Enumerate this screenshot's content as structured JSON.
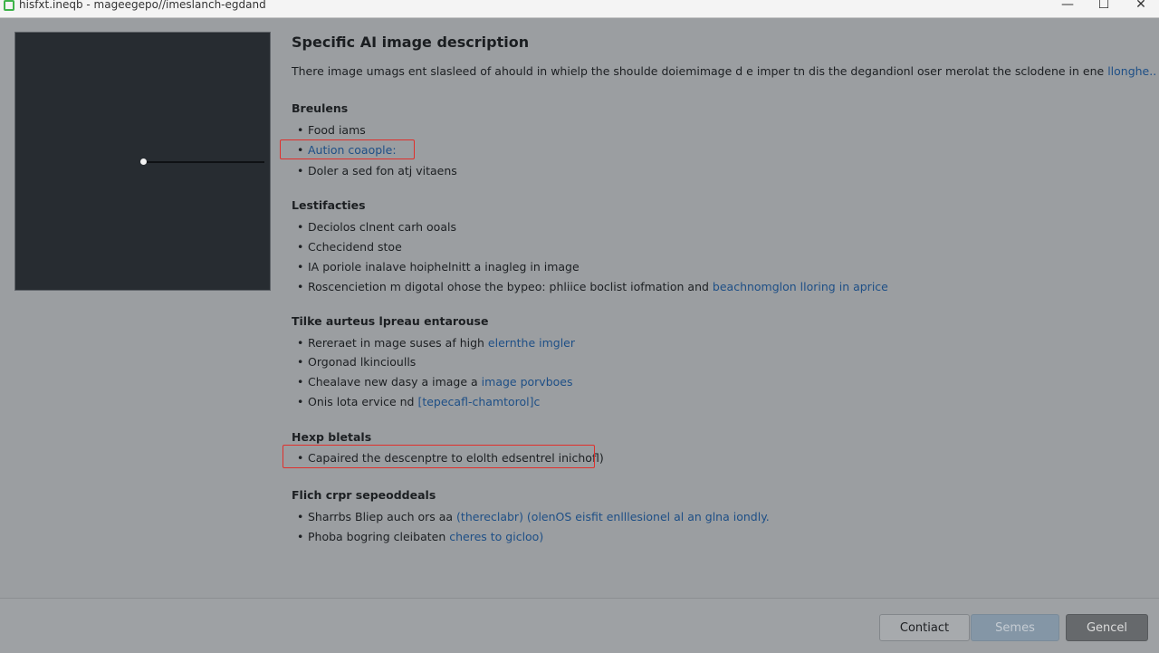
{
  "window": {
    "title": "hisfxt.ineqb - mageegepo//imeslanch-egdand",
    "minimize": "—",
    "maximize": "☐",
    "close": "✕"
  },
  "main": {
    "title": "Specific AI image description",
    "intro_text": "There image umags ent slasleed of ahould in whielp the shoulde doiemimage d e imper tn dis the degandionl oser merolat the sclodene in ene ",
    "intro_link": "llonghe.."
  },
  "sections": [
    {
      "heading": "Breulens",
      "items": [
        {
          "text": "Food iams",
          "link": ""
        },
        {
          "text": "Aution coaople:",
          "link": "",
          "highlighted": true
        },
        {
          "text": "Doler a sed fon atj vitaens",
          "link": ""
        }
      ]
    },
    {
      "heading": "Lestifacties",
      "items": [
        {
          "text": "Deciolos clnent carh ooals",
          "link": ""
        },
        {
          "text": "Cchecidend stoe",
          "link": ""
        },
        {
          "text": "IA poriole inalave hoiphelnitt a inagleg in image",
          "link": ""
        },
        {
          "text": "Roscencietion m digotal ohose the bypeo: phliice boclist iofmation and ",
          "link": "beachnomglon lloring in aprice"
        }
      ]
    },
    {
      "heading": "Tilke aurteus lpreau entarouse",
      "items": [
        {
          "text": "Rereraet in mage suses af high ",
          "link": "elernthe imgler"
        },
        {
          "text": "Orgonad lkincioulls",
          "link": ""
        },
        {
          "text": "Chealave new dasy a image a ",
          "link": "image porvboes"
        },
        {
          "text": "Onis lota ervice nd ",
          "link": "[tepecafl-chamtorol]c"
        }
      ]
    },
    {
      "heading": "Hexp bletals",
      "items": [
        {
          "text": "Capaired the descenptre to elolth edsentrel inichofl)",
          "link": "",
          "highlighted": true
        }
      ]
    },
    {
      "heading": "Flich crpr sepeoddeals",
      "items": [
        {
          "text": "Sharrbs Bliep auch ors aa ",
          "link": "(thereclabr)  (olenOS eisfit enlllesionel al an glna iondly."
        },
        {
          "text": "Phoba bogring cleibaten ",
          "link": "cheres to gicloo)"
        }
      ]
    }
  ],
  "footer": {
    "contact_label": "Contiact",
    "send_label": "Semes",
    "cancel_label": "Gencel"
  },
  "colors": {
    "accent_link": "#1e4f86",
    "highlight_border": "#e0302c",
    "app_icon": "#3eb34a"
  }
}
